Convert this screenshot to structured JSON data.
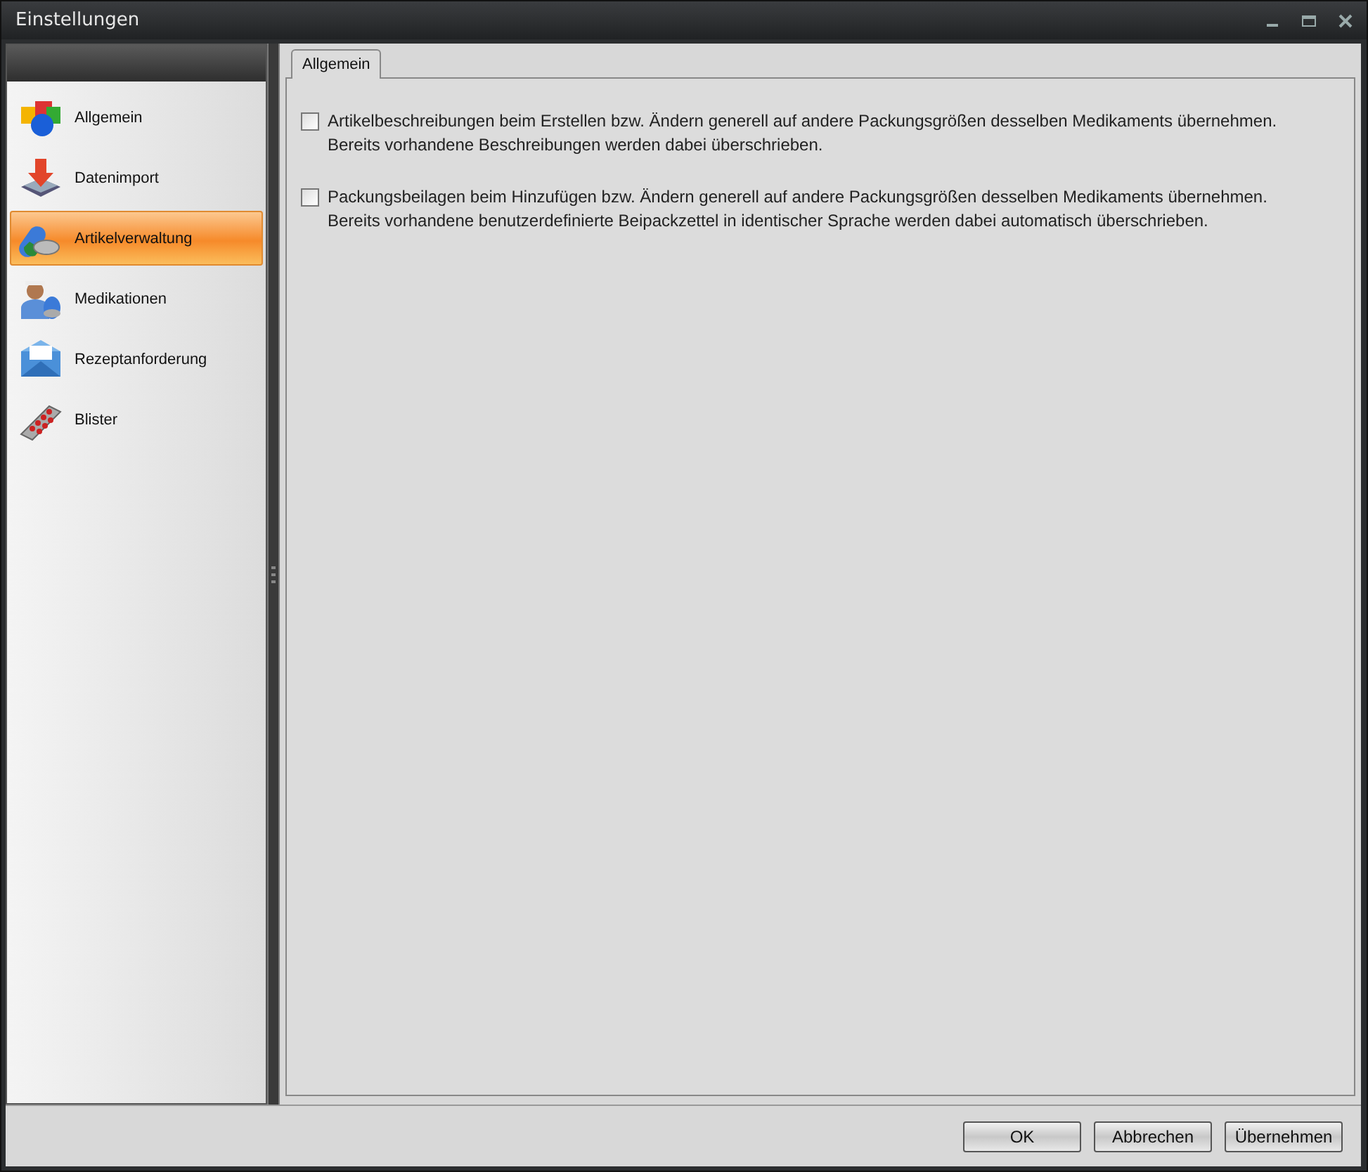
{
  "window": {
    "title": "Einstellungen"
  },
  "sidebar": {
    "items": [
      {
        "label": "Allgemein",
        "selected": false
      },
      {
        "label": "Datenimport",
        "selected": false
      },
      {
        "label": "Artikelverwaltung",
        "selected": true
      },
      {
        "label": "Medikationen",
        "selected": false
      },
      {
        "label": "Rezeptanforderung",
        "selected": false
      },
      {
        "label": "Blister",
        "selected": false
      }
    ]
  },
  "tabs": [
    {
      "label": "Allgemein",
      "selected": true
    }
  ],
  "options": [
    {
      "lines": [
        "Artikelbeschreibungen beim Erstellen bzw. Ändern generell auf andere Packungsgrößen desselben Medikaments übernehmen.",
        "Bereits vorhandene Beschreibungen werden dabei überschrieben."
      ],
      "checked": false
    },
    {
      "lines": [
        "Packungsbeilagen beim Hinzufügen bzw. Ändern generell auf andere Packungsgrößen desselben Medikaments übernehmen.",
        "Bereits vorhandene benutzerdefinierte Beipackzettel in identischer Sprache werden dabei automatisch überschrieben."
      ],
      "checked": false
    }
  ],
  "buttons": [
    "OK",
    "Abbrechen",
    "Übernehmen"
  ]
}
